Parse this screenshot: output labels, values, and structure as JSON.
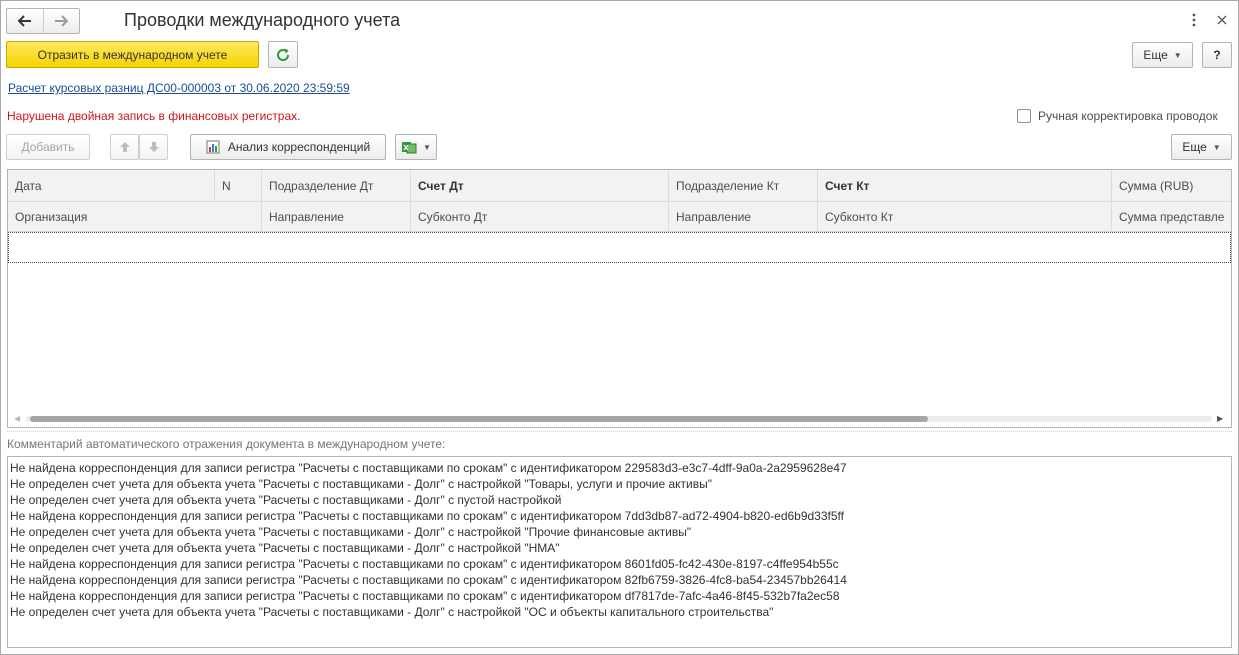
{
  "window": {
    "title": "Проводки международного учета",
    "more_icon": "vertical-dots-icon",
    "close_icon": "close-icon"
  },
  "nav": {
    "back_icon": "arrow-left-icon",
    "forward_icon": "arrow-right-icon"
  },
  "toolbar": {
    "primary_label": "Отразить в международном учете",
    "refresh_icon": "refresh-icon",
    "more_label": "Еще",
    "help_label": "?"
  },
  "document_link": "Расчет курсовых разниц ДС00-000003 от 30.06.2020 23:59:59",
  "error_message": "Нарушена двойная запись в финансовых регистрах.",
  "manual_correction": {
    "label": "Ручная корректировка проводок",
    "checked": false
  },
  "table_toolbar": {
    "add_label": "Добавить",
    "up_icon": "arrow-up-icon",
    "down_icon": "arrow-down-icon",
    "analysis_label": "Анализ корреспонденций",
    "analysis_icon": "chart-icon",
    "export_icon": "excel-export-icon",
    "more_label": "Еще"
  },
  "table": {
    "header_row1": [
      "Дата",
      "N",
      "Подразделение Дт",
      "Счет Дт",
      "Подразделение Кт",
      "Счет Кт",
      "Сумма (RUB)"
    ],
    "header_row2": [
      "Организация",
      "Направление",
      "Субконто Дт",
      "Направление",
      "Субконто Кт",
      "Сумма представле"
    ]
  },
  "comment": {
    "label": "Комментарий автоматического отражения документа в международном учете:",
    "lines": [
      "Не найдена корреспонденция для записи регистра \"Расчеты с поставщиками по срокам\" с идентификатором 229583d3-e3c7-4dff-9a0a-2a2959628e47",
      "Не определен счет учета для объекта учета \"Расчеты с поставщиками - Долг\" с настройкой \"Товары, услуги и прочие активы\"",
      "Не определен счет учета для объекта учета \"Расчеты с поставщиками - Долг\" с пустой настройкой",
      "Не найдена корреспонденция для записи регистра \"Расчеты с поставщиками по срокам\" с идентификатором 7dd3db87-ad72-4904-b820-ed6b9d33f5ff",
      "Не определен счет учета для объекта учета \"Расчеты с поставщиками - Долг\" с настройкой \"Прочие финансовые активы\"",
      "Не определен счет учета для объекта учета \"Расчеты с поставщиками - Долг\" с настройкой \"НМА\"",
      "Не найдена корреспонденция для записи регистра \"Расчеты с поставщиками по срокам\" с идентификатором 8601fd05-fc42-430e-8197-c4ffe954b55c",
      "Не найдена корреспонденция для записи регистра \"Расчеты с поставщиками по срокам\" с идентификатором 82fb6759-3826-4fc8-ba54-23457bb26414",
      "Не найдена корреспонденция для записи регистра \"Расчеты с поставщиками по срокам\" с идентификатором df7817de-7afc-4a46-8f45-532b7fa2ec58",
      "Не определен счет учета для объекта учета \"Расчеты с поставщиками - Долг\" с настройкой \"ОС и объекты капитального строительства\""
    ]
  },
  "colors": {
    "primary_button": "#f5d400",
    "error_text": "#d0161b",
    "link_text": "#1a4f8f",
    "refresh_icon": "#2e9b3b"
  }
}
